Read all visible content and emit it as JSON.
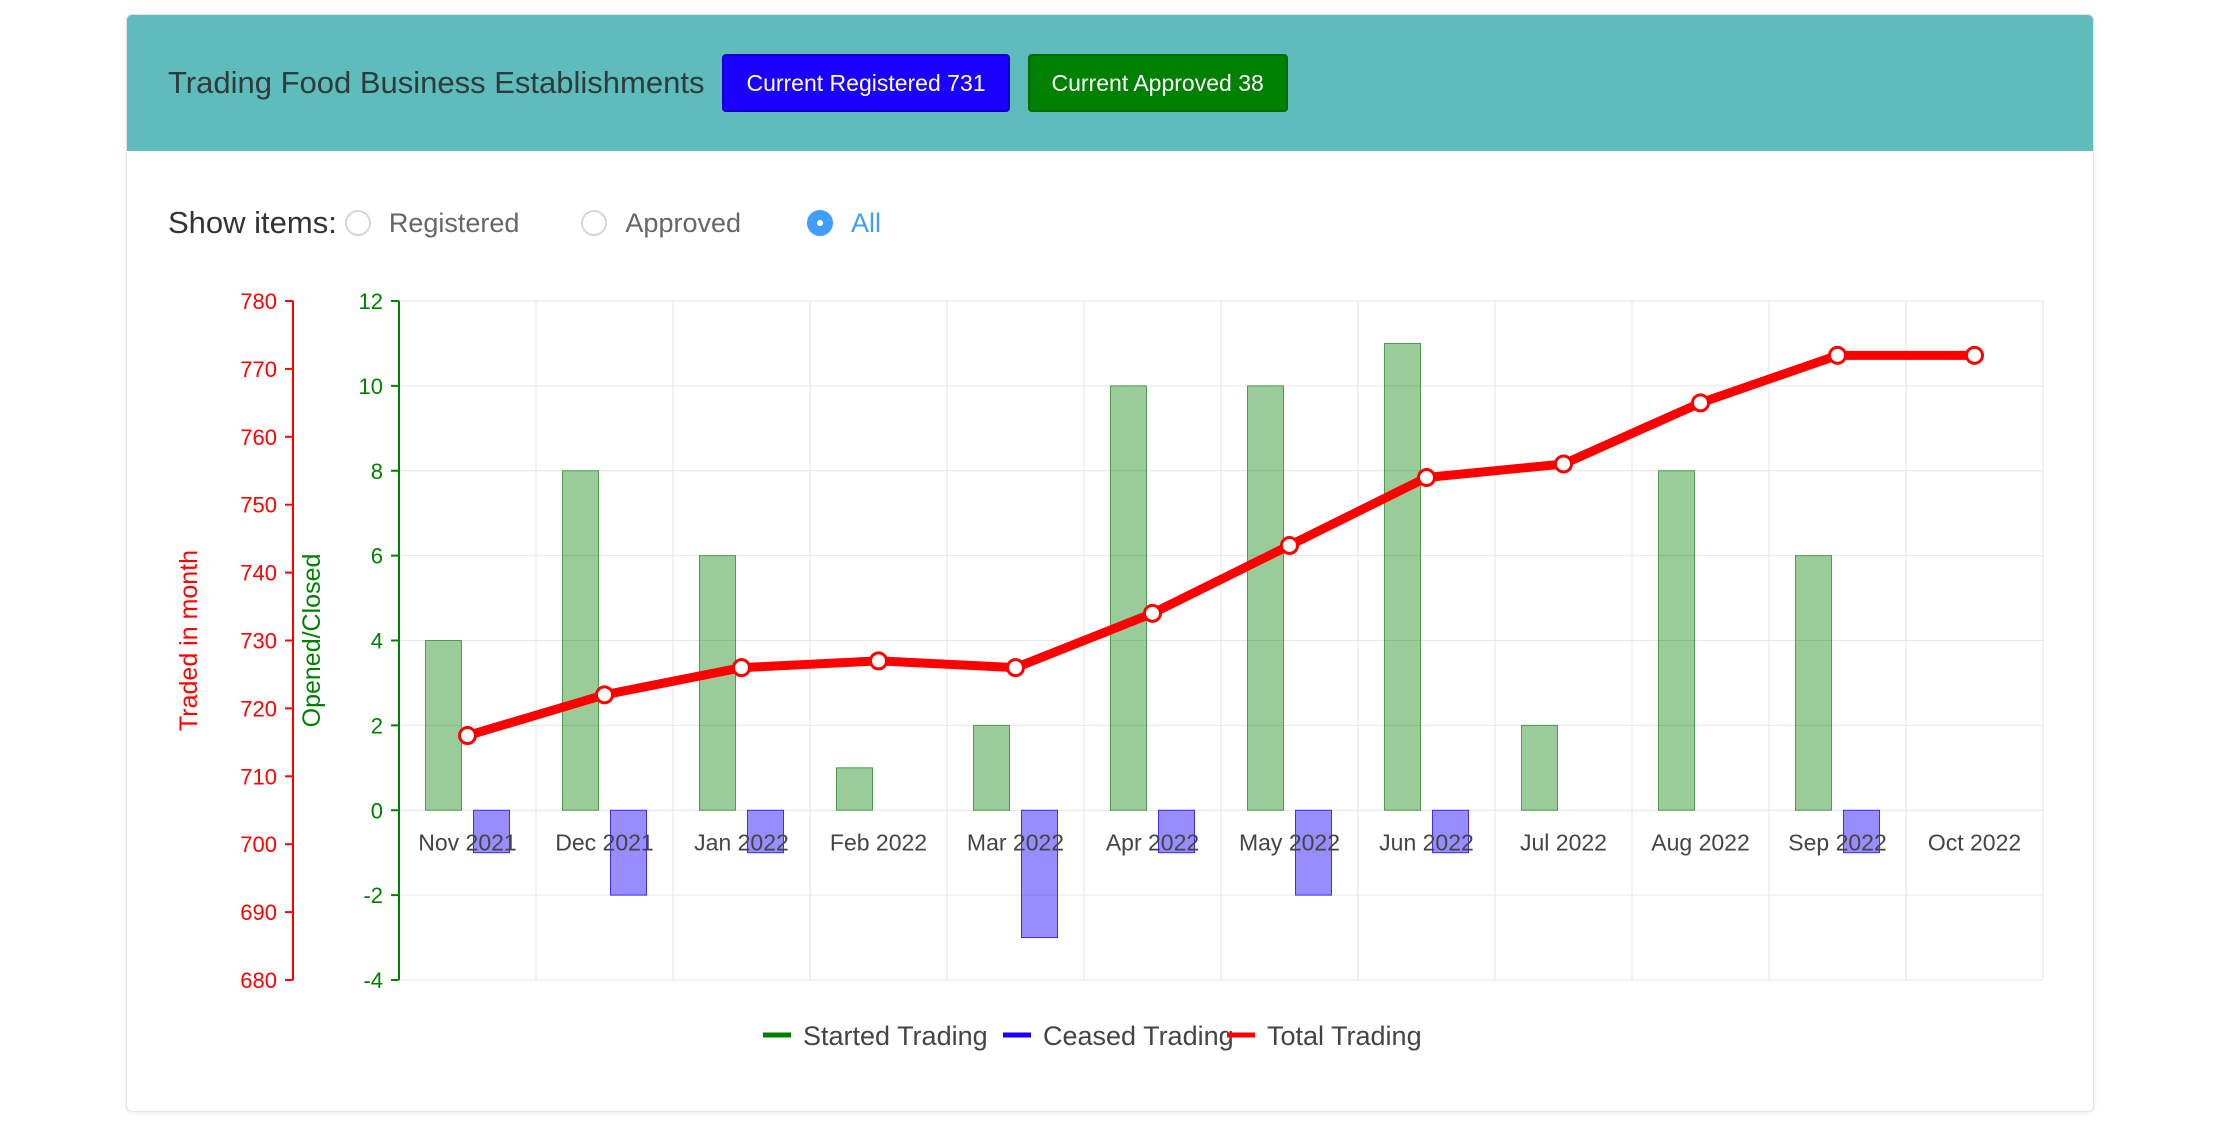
{
  "header": {
    "title": "Trading Food Business Establishments",
    "registered_badge": "Current Registered 731",
    "approved_badge": "Current Approved 38"
  },
  "filter": {
    "label": "Show items:",
    "options": [
      "Registered",
      "Approved",
      "All"
    ],
    "selected": "All"
  },
  "colors": {
    "header_bg": "#5fbcbc",
    "started": "#008000",
    "ceased": "#1a00ff",
    "total": "#ff0000",
    "radio_active": "#409eff"
  },
  "chart_data": {
    "type": "bar",
    "categories": [
      "Nov 2021",
      "Dec 2021",
      "Jan 2022",
      "Feb 2022",
      "Mar 2022",
      "Apr 2022",
      "May 2022",
      "Jun 2022",
      "Jul 2022",
      "Aug 2022",
      "Sep 2022",
      "Oct 2022"
    ],
    "series": [
      {
        "name": "Started Trading",
        "type": "bar",
        "axis": "left",
        "values": [
          4,
          8,
          6,
          1,
          2,
          10,
          10,
          11,
          2,
          8,
          6,
          0
        ]
      },
      {
        "name": "Ceased Trading",
        "type": "bar",
        "axis": "left",
        "values": [
          -1,
          -2,
          -1,
          0,
          -3,
          -1,
          -2,
          -1,
          0,
          0,
          -1,
          0
        ]
      },
      {
        "name": "Total Trading",
        "type": "line",
        "axis": "right",
        "values": [
          716,
          722,
          726,
          727,
          726,
          734,
          744,
          754,
          756,
          765,
          772,
          772
        ]
      }
    ],
    "y_left": {
      "label": "Opened/Closed",
      "min": -4,
      "max": 12,
      "ticks": [
        "12",
        "10",
        "8",
        "6",
        "4",
        "2",
        "0",
        "-2",
        "-4"
      ]
    },
    "y_right": {
      "label": "Traded in month",
      "min": 680,
      "max": 780,
      "ticks": [
        "780",
        "770",
        "760",
        "750",
        "740",
        "730",
        "720",
        "710",
        "700",
        "690",
        "680"
      ]
    },
    "legend": [
      "Started Trading",
      "Ceased Trading",
      "Total Trading"
    ],
    "legend_position": "bottom",
    "grid": true
  }
}
